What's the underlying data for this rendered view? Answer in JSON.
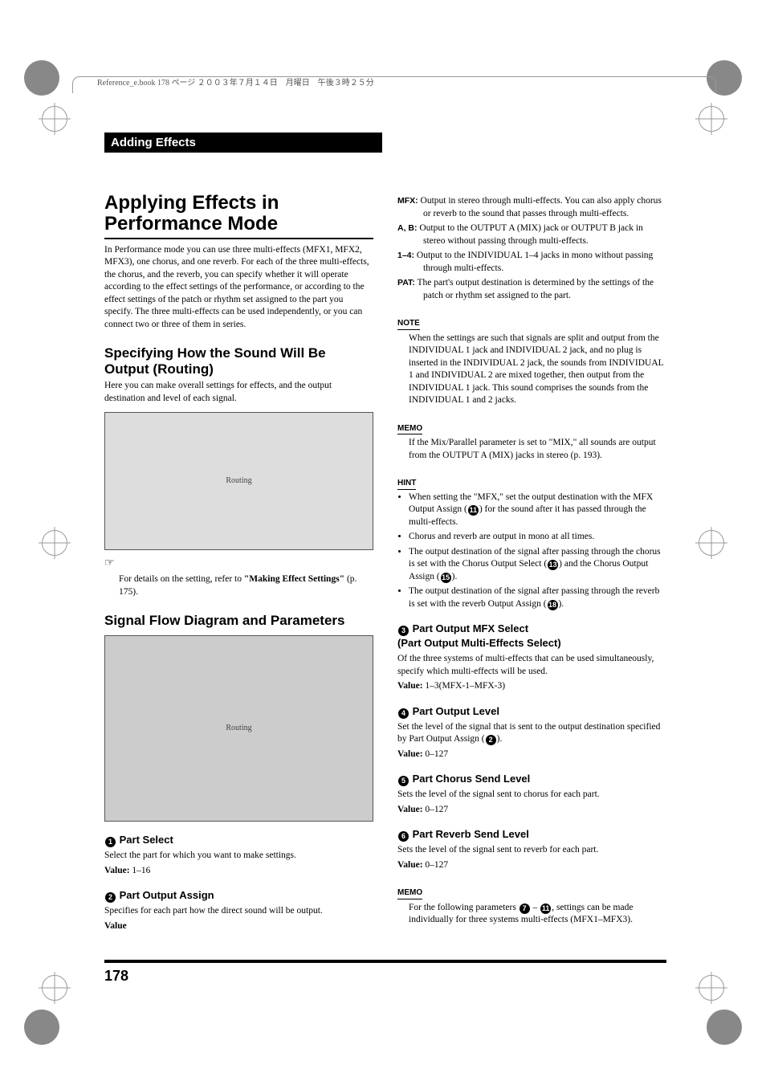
{
  "print_header": "Reference_e.book  178 ページ  ２００３年７月１４日　月曜日　午後３時２５分",
  "section_bar": "Adding Effects",
  "h1": "Applying Effects in Performance Mode",
  "intro": "In Performance mode you can use three multi-effects (MFX1, MFX2, MFX3), one chorus, and one reverb. For each of the three multi-effects, the chorus, and the reverb, you can specify whether it will operate according to the effect settings of the performance, or according to the effect settings of the patch or rhythm set assigned to the part you specify. The three multi-effects can be used independently, or you can connect two or three of them in series.",
  "h2_routing": "Specifying How the Sound Will Be Output (Routing)",
  "routing_intro": "Here you can make overall settings for effects, and the output destination and level of each signal.",
  "fig1_label": "Routing",
  "details_ref_pre": "For details on the setting, refer to ",
  "details_ref_bold": "\"Making Effect Settings\"",
  "details_ref_post": " (p. 175).",
  "h2_signal": "Signal Flow Diagram and Parameters",
  "fig2_label": "Routing",
  "h3_1": "Part Select",
  "p1_desc": "Select the part for which you want to make settings.",
  "p1_val_label": "Value:",
  "p1_val": " 1–16",
  "h3_2": "Part Output Assign",
  "p2_desc": "Specifies for each part how the direct sound will be output.",
  "p2_val_label": "Value",
  "mfx_label": "MFX:",
  "mfx_text": " Output in stereo through multi-effects. You can also apply chorus or reverb to the sound that passes through multi-effects.",
  "ab_label": "A, B:",
  "ab_text": " Output to the OUTPUT A (MIX) jack or OUTPUT B jack in stereo without passing through multi-effects.",
  "n14_label": "1–4:",
  "n14_text": " Output to the INDIVIDUAL 1–4 jacks in mono without passing through multi-effects.",
  "pat_label": "PAT:",
  "pat_text": " The part's output destination is determined by the settings of the patch or rhythm set assigned to the part.",
  "note1": "When the settings are such that signals are split and output from the INDIVIDUAL 1 jack and INDIVIDUAL 2 jack, and no plug is inserted in the INDIVIDUAL 2 jack, the sounds from INDIVIDUAL 1 and INDIVIDUAL 2 are mixed together, then output from the INDIVIDUAL 1 jack. This sound comprises the sounds from the INDIVIDUAL 1 and 2 jacks.",
  "memo1": "If the Mix/Parallel parameter is set to \"MIX,\" all sounds are output from the OUTPUT A (MIX) jacks in stereo (p. 193).",
  "hint_b1_pre": "When setting the \"MFX,\" set the output destination with the MFX Output Assign (",
  "hint_b1_post": ") for the sound after it has passed through the multi-effects.",
  "hint_b2": "Chorus and reverb are output in mono at all times.",
  "hint_b3_pre": "The output destination of the signal after passing through the chorus is set with the Chorus Output Select (",
  "hint_b3_mid": ") and the Chorus Output Assign (",
  "hint_b3_post": ").",
  "hint_b4_pre": "The output destination of the signal after passing through the reverb is set with the reverb Output Assign (",
  "hint_b4_post": ").",
  "h3_3a": "Part Output MFX Select",
  "h3_3b": "(Part Output Multi-Effects Select)",
  "p3_desc": "Of the three systems of multi-effects that can be used simultaneously, specify which multi-effects will be used.",
  "p3_val_label": "Value:",
  "p3_val": " 1–3(MFX-1–MFX-3)",
  "h3_4": "Part Output Level",
  "p4_desc_pre": "Set the level of the signal that is sent to the output destination specified by Part Output Assign (",
  "p4_desc_post": ").",
  "p4_val_label": "Value:",
  "p4_val": " 0–127",
  "h3_5": "Part Chorus Send Level",
  "p5_desc": "Sets the level of the signal sent to chorus for each part.",
  "p5_val_label": "Value:",
  "p5_val": " 0–127",
  "h3_6": "Part Reverb Send Level",
  "p6_desc": "Sets the level of the signal sent to reverb for each part.",
  "p6_val_label": "Value:",
  "p6_val": " 0–127",
  "memo2_pre": "For the following parameters ",
  "memo2_mid": " – ",
  "memo2_post": ", settings can be made individually for three systems multi-effects (MFX1–MFX3).",
  "page_number": "178",
  "circ": {
    "n1": "1",
    "n2": "2",
    "n3": "3",
    "n4": "4",
    "n5": "5",
    "n6": "6",
    "n7": "7",
    "n11": "11",
    "n13": "13",
    "n15": "15",
    "n18": "18"
  }
}
